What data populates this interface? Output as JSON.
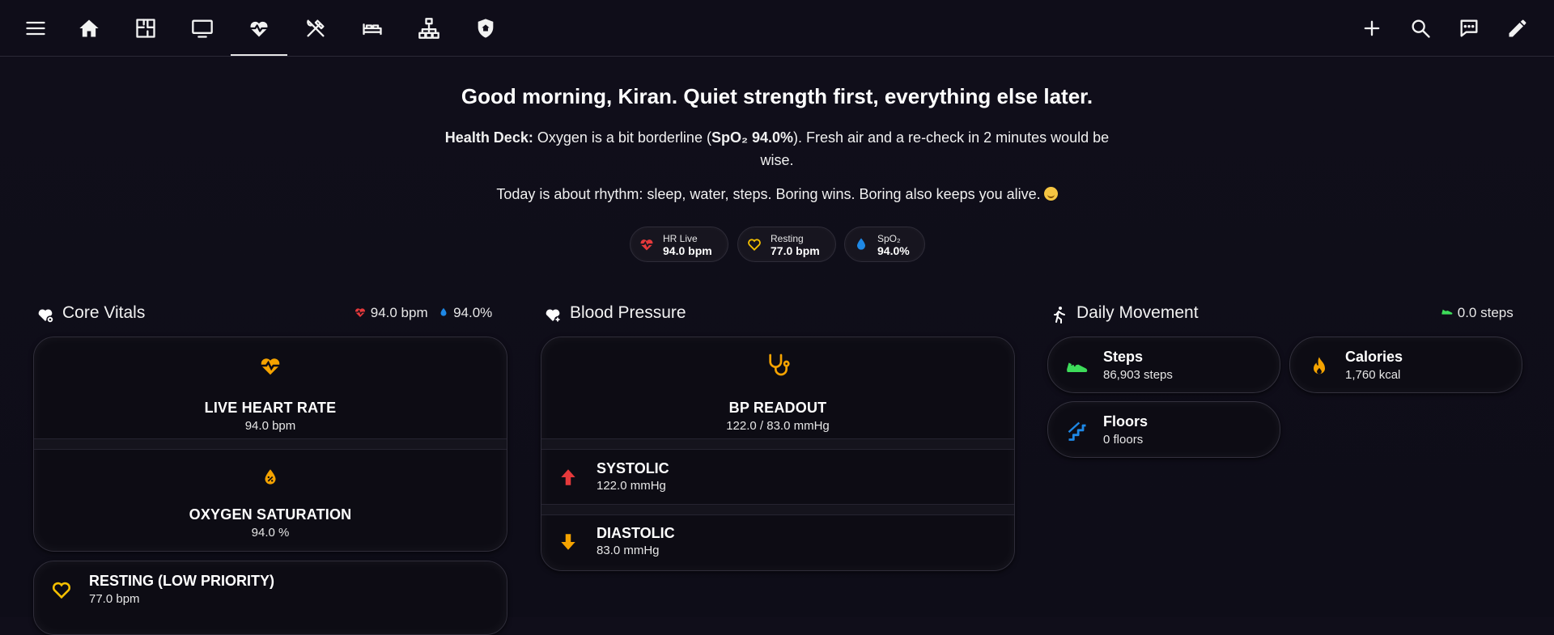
{
  "topbar": {
    "icons": [
      "menu-icon",
      "home-icon",
      "floorplan-icon",
      "tv-icon",
      "heart-pulse-icon",
      "utensils-icon",
      "bed-icon",
      "network-icon",
      "shield-home-icon"
    ],
    "right_icons": [
      "plus-icon",
      "search-icon",
      "chat-icon",
      "pencil-icon"
    ],
    "active_tab": "heart-pulse-icon"
  },
  "header": {
    "greeting": "Good morning, Kiran. Quiet strength first, everything else later.",
    "deck_label": "Health Deck:",
    "deck_pre": " Oxygen is a bit borderline (",
    "deck_bold": "SpO₂ 94.0%",
    "deck_post": "). Fresh air and a re-check in 2 minutes would be wise.",
    "rhythm": "Today is about rhythm: sleep, water, steps. Boring wins. Boring also keeps you alive."
  },
  "chips": [
    {
      "label": "HR Live",
      "value": "94.0 bpm",
      "icon": "heart-pulse-icon",
      "color": "#e5393b"
    },
    {
      "label": "Resting",
      "value": "77.0 bpm",
      "icon": "heart-outline-icon",
      "color": "#f5c000"
    },
    {
      "label": "SpO₂",
      "value": "94.0%",
      "icon": "water-drop-icon",
      "color": "#1e88e5"
    }
  ],
  "core_vitals": {
    "title": "Core Vitals",
    "hr_summary": "94.0 bpm",
    "spo2_summary": "94.0%",
    "live_hr": {
      "label": "LIVE HEART RATE",
      "value": "94.0 bpm"
    },
    "oxygen": {
      "label": "OXYGEN SATURATION",
      "value": "94.0 %"
    },
    "resting": {
      "label": "RESTING (LOW PRIORITY)",
      "value": "77.0 bpm"
    }
  },
  "blood_pressure": {
    "title": "Blood Pressure",
    "readout": {
      "label": "BP READOUT",
      "value": "122.0 / 83.0 mmHg"
    },
    "systolic": {
      "label": "SYSTOLIC",
      "value": "122.0 mmHg"
    },
    "diastolic": {
      "label": "DIASTOLIC",
      "value": "83.0 mmHg"
    }
  },
  "movement": {
    "title": "Daily Movement",
    "steps_summary": "0.0 steps",
    "steps": {
      "label": "Steps",
      "value": "86,903 steps"
    },
    "calories": {
      "label": "Calories",
      "value": "1,760 kcal"
    },
    "floors": {
      "label": "Floors",
      "value": "0 floors"
    }
  },
  "colors": {
    "accent_orange": "#f5a300",
    "red": "#e5393b",
    "blue": "#1e88e5",
    "green": "#3ddc5a"
  }
}
